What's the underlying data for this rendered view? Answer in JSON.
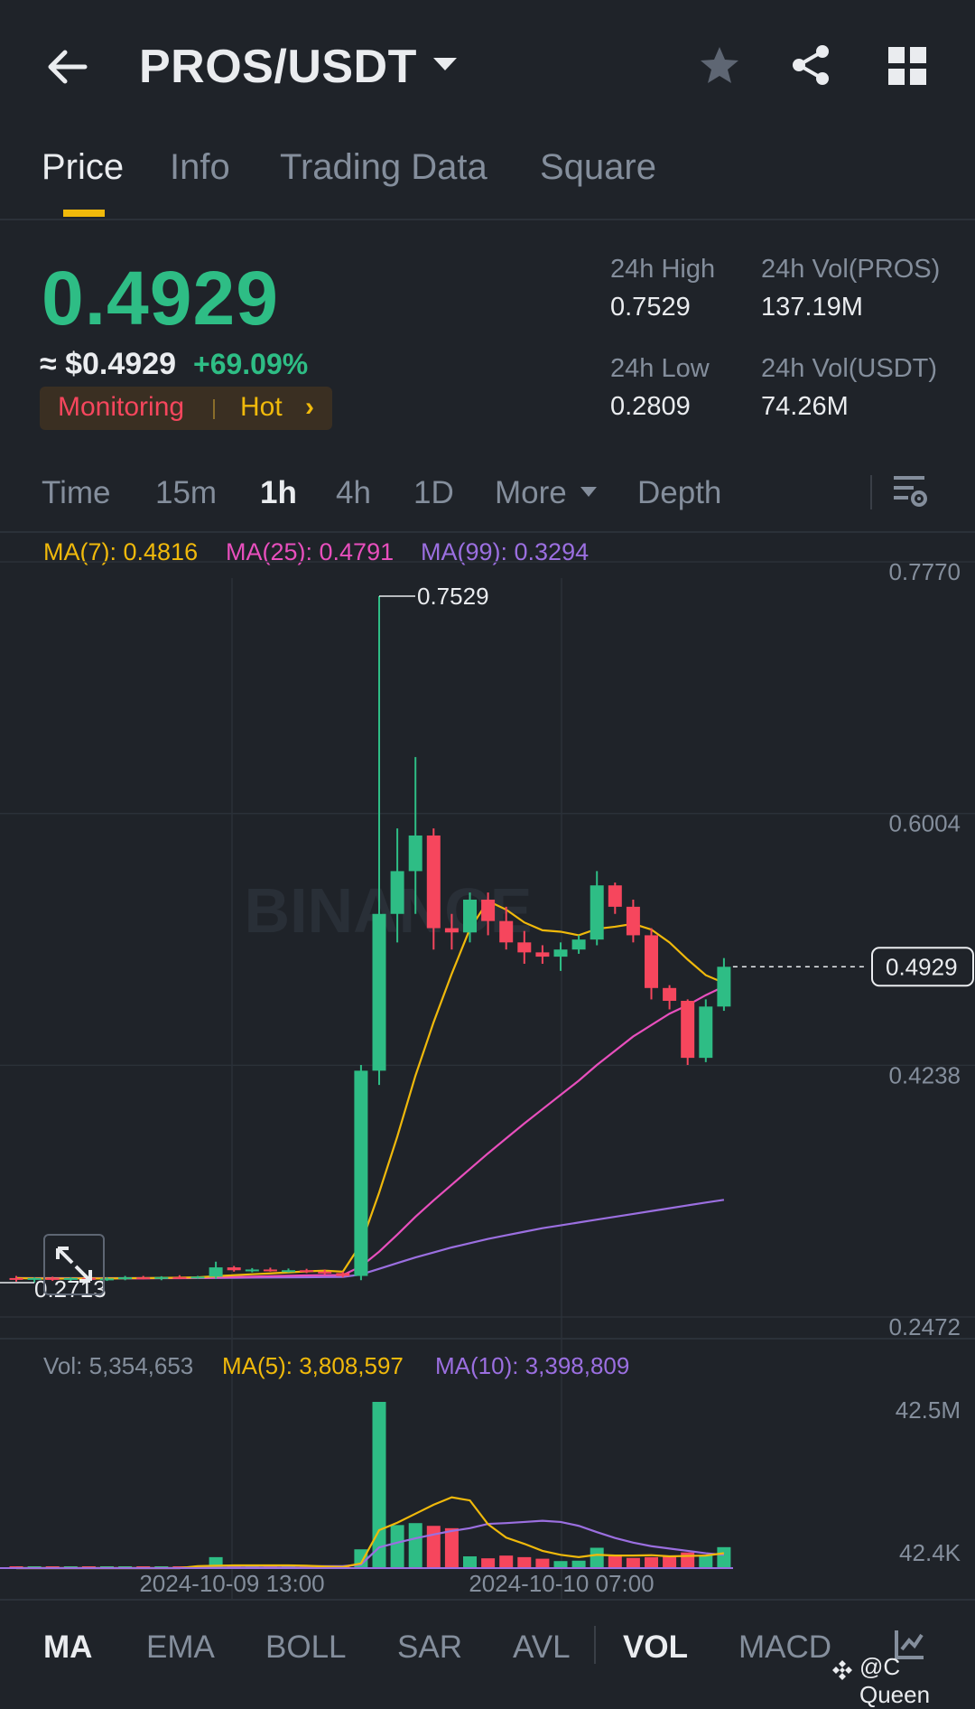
{
  "header": {
    "pair": "PROS/USDT"
  },
  "tabs": [
    "Price",
    "Info",
    "Trading Data",
    "Square"
  ],
  "price": {
    "last": "0.4929",
    "approx": "≈ $0.4929",
    "change": "+69.09%",
    "tag_monitoring": "Monitoring",
    "tag_hot": "Hot"
  },
  "stats": {
    "high_label": "24h High",
    "high_value": "0.7529",
    "low_label": "24h Low",
    "low_value": "0.2809",
    "vol_base_label": "24h Vol(PROS)",
    "vol_base_value": "137.19M",
    "vol_quote_label": "24h Vol(USDT)",
    "vol_quote_value": "74.26M"
  },
  "intervals": [
    "Time",
    "15m",
    "1h",
    "4h",
    "1D",
    "More",
    "Depth"
  ],
  "active_interval": "1h",
  "ma_legend": {
    "ma7": "MA(7): 0.4816",
    "ma25": "MA(25): 0.4791",
    "ma99": "MA(99): 0.3294"
  },
  "vol_legend": {
    "vol": "Vol: 5,354,653",
    "ma5": "MA(5): 3,808,597",
    "ma10": "MA(10): 3,398,809"
  },
  "bottom_indicators": [
    "MA",
    "EMA",
    "BOLL",
    "SAR",
    "AVL",
    "VOL",
    "MACD"
  ],
  "watermark": "@C Queen",
  "colors": {
    "up": "#2ebd85",
    "down": "#f6465d",
    "ma7": "#f0b90b",
    "ma25": "#e84fbd",
    "ma99": "#9b6fe0",
    "accent": "#f0b90b"
  },
  "chart_data": {
    "type": "candlestick",
    "price_axis_ticks": [
      "0.7770",
      "0.6004",
      "0.4238",
      "0.2472"
    ],
    "ylim": [
      0.2472,
      0.777
    ],
    "high_marker": "0.7529",
    "low_marker": "0.2713",
    "last_price_marker": "0.4929",
    "volume_axis_ticks": [
      "42.5M",
      "42.4K"
    ],
    "vol_max": 42500000,
    "x_tick_labels": [
      "2024-10-09 13:00",
      "2024-10-10 07:00"
    ],
    "candles": [
      {
        "o": 0.2745,
        "h": 0.276,
        "l": 0.272,
        "c": 0.2735
      },
      {
        "o": 0.2735,
        "h": 0.275,
        "l": 0.2713,
        "c": 0.2745
      },
      {
        "o": 0.2745,
        "h": 0.2755,
        "l": 0.2725,
        "c": 0.274
      },
      {
        "o": 0.274,
        "h": 0.275,
        "l": 0.2725,
        "c": 0.2745
      },
      {
        "o": 0.2745,
        "h": 0.2755,
        "l": 0.273,
        "c": 0.274
      },
      {
        "o": 0.274,
        "h": 0.275,
        "l": 0.2725,
        "c": 0.2742
      },
      {
        "o": 0.2742,
        "h": 0.276,
        "l": 0.273,
        "c": 0.275
      },
      {
        "o": 0.275,
        "h": 0.276,
        "l": 0.2735,
        "c": 0.2745
      },
      {
        "o": 0.2745,
        "h": 0.2758,
        "l": 0.273,
        "c": 0.2752
      },
      {
        "o": 0.2752,
        "h": 0.2765,
        "l": 0.274,
        "c": 0.2748
      },
      {
        "o": 0.2748,
        "h": 0.276,
        "l": 0.274,
        "c": 0.2755
      },
      {
        "o": 0.2755,
        "h": 0.286,
        "l": 0.274,
        "c": 0.282
      },
      {
        "o": 0.282,
        "h": 0.283,
        "l": 0.279,
        "c": 0.28
      },
      {
        "o": 0.28,
        "h": 0.2815,
        "l": 0.2785,
        "c": 0.2805
      },
      {
        "o": 0.2805,
        "h": 0.2818,
        "l": 0.279,
        "c": 0.2795
      },
      {
        "o": 0.2795,
        "h": 0.2812,
        "l": 0.2785,
        "c": 0.28
      },
      {
        "o": 0.28,
        "h": 0.281,
        "l": 0.278,
        "c": 0.279
      },
      {
        "o": 0.279,
        "h": 0.2805,
        "l": 0.277,
        "c": 0.278
      },
      {
        "o": 0.278,
        "h": 0.279,
        "l": 0.275,
        "c": 0.276
      },
      {
        "o": 0.276,
        "h": 0.424,
        "l": 0.273,
        "c": 0.42
      },
      {
        "o": 0.42,
        "h": 0.7529,
        "l": 0.41,
        "c": 0.53
      },
      {
        "o": 0.53,
        "h": 0.59,
        "l": 0.51,
        "c": 0.56
      },
      {
        "o": 0.56,
        "h": 0.64,
        "l": 0.53,
        "c": 0.585
      },
      {
        "o": 0.585,
        "h": 0.59,
        "l": 0.505,
        "c": 0.52
      },
      {
        "o": 0.52,
        "h": 0.53,
        "l": 0.505,
        "c": 0.517
      },
      {
        "o": 0.517,
        "h": 0.545,
        "l": 0.51,
        "c": 0.54
      },
      {
        "o": 0.54,
        "h": 0.545,
        "l": 0.515,
        "c": 0.525
      },
      {
        "o": 0.525,
        "h": 0.535,
        "l": 0.505,
        "c": 0.51
      },
      {
        "o": 0.51,
        "h": 0.518,
        "l": 0.495,
        "c": 0.503
      },
      {
        "o": 0.503,
        "h": 0.508,
        "l": 0.495,
        "c": 0.5
      },
      {
        "o": 0.5,
        "h": 0.51,
        "l": 0.49,
        "c": 0.505
      },
      {
        "o": 0.505,
        "h": 0.515,
        "l": 0.502,
        "c": 0.512
      },
      {
        "o": 0.512,
        "h": 0.56,
        "l": 0.508,
        "c": 0.55
      },
      {
        "o": 0.55,
        "h": 0.552,
        "l": 0.53,
        "c": 0.535
      },
      {
        "o": 0.535,
        "h": 0.54,
        "l": 0.51,
        "c": 0.515
      },
      {
        "o": 0.515,
        "h": 0.52,
        "l": 0.47,
        "c": 0.478
      },
      {
        "o": 0.478,
        "h": 0.48,
        "l": 0.463,
        "c": 0.469
      },
      {
        "o": 0.469,
        "h": 0.47,
        "l": 0.424,
        "c": 0.429
      },
      {
        "o": 0.429,
        "h": 0.47,
        "l": 0.426,
        "c": 0.465
      },
      {
        "o": 0.465,
        "h": 0.499,
        "l": 0.462,
        "c": 0.4929
      }
    ],
    "ma7": [
      0.2745,
      0.2742,
      0.2741,
      0.2742,
      0.2742,
      0.2742,
      0.2744,
      0.2745,
      0.2746,
      0.2748,
      0.275,
      0.2758,
      0.2765,
      0.2772,
      0.2778,
      0.2785,
      0.2792,
      0.2797,
      0.279,
      0.2985,
      0.3345,
      0.3738,
      0.4165,
      0.454,
      0.488,
      0.5195,
      0.539,
      0.533,
      0.524,
      0.5185,
      0.5175,
      0.515,
      0.5195,
      0.521,
      0.523,
      0.519,
      0.51,
      0.498,
      0.487,
      0.4816
    ],
    "ma25": [
      0.2745,
      0.2744,
      0.2743,
      0.2743,
      0.2743,
      0.2743,
      0.2743,
      0.2743,
      0.2744,
      0.2744,
      0.2745,
      0.2748,
      0.2752,
      0.2755,
      0.2758,
      0.2761,
      0.2764,
      0.2765,
      0.2766,
      0.2827,
      0.293,
      0.305,
      0.3175,
      0.329,
      0.34,
      0.351,
      0.362,
      0.3725,
      0.383,
      0.393,
      0.403,
      0.413,
      0.424,
      0.434,
      0.444,
      0.452,
      0.46,
      0.466,
      0.473,
      0.4791
    ],
    "ma99": [
      0.2745,
      0.2745,
      0.2745,
      0.2745,
      0.2745,
      0.2745,
      0.2745,
      0.2745,
      0.2745,
      0.2745,
      0.2745,
      0.2746,
      0.2747,
      0.2748,
      0.2749,
      0.275,
      0.2751,
      0.2752,
      0.2753,
      0.277,
      0.281,
      0.285,
      0.289,
      0.2925,
      0.296,
      0.299,
      0.302,
      0.3045,
      0.307,
      0.3095,
      0.3115,
      0.3135,
      0.3155,
      0.3175,
      0.3195,
      0.3215,
      0.3235,
      0.3255,
      0.3275,
      0.3294
    ],
    "volumes": [
      20000,
      20000,
      20000,
      20000,
      20000,
      20000,
      20000,
      20000,
      20000,
      20000,
      20000,
      2800000,
      300000,
      200000,
      200000,
      200000,
      200000,
      200000,
      300000,
      4800000,
      42500000,
      11000000,
      11500000,
      10800000,
      10200000,
      3000000,
      2500000,
      3200000,
      2800000,
      2400000,
      1800000,
      1900000,
      5200000,
      3000000,
      2600000,
      2800000,
      3000000,
      4000000,
      3200000,
      5354653
    ],
    "vol_ma5": [
      0,
      0,
      0,
      0,
      0,
      0,
      0,
      0,
      0,
      0,
      500000,
      600000,
      700000,
      700000,
      700000,
      700000,
      600000,
      400000,
      300000,
      1200000,
      9700000,
      11600000,
      13900000,
      16200000,
      18100000,
      17300000,
      11200000,
      7800000,
      6200000,
      4400000,
      3400000,
      2800000,
      3400000,
      3200000,
      3200000,
      3300000,
      3000000,
      3100000,
      3200000,
      3808597
    ],
    "vol_ma10": [
      0,
      0,
      0,
      0,
      0,
      0,
      0,
      0,
      0,
      0,
      400000,
      500000,
      500000,
      500000,
      500000,
      500000,
      500000,
      500000,
      500000,
      900000,
      5300000,
      6500000,
      7600000,
      8600000,
      9500000,
      10200000,
      11300000,
      11500000,
      11800000,
      12100000,
      11800000,
      10800000,
      9200000,
      7700000,
      6500000,
      5600000,
      5000000,
      4400000,
      3800000,
      3398809
    ]
  },
  "misc": {
    "faint_watermark": "BINANCE"
  }
}
